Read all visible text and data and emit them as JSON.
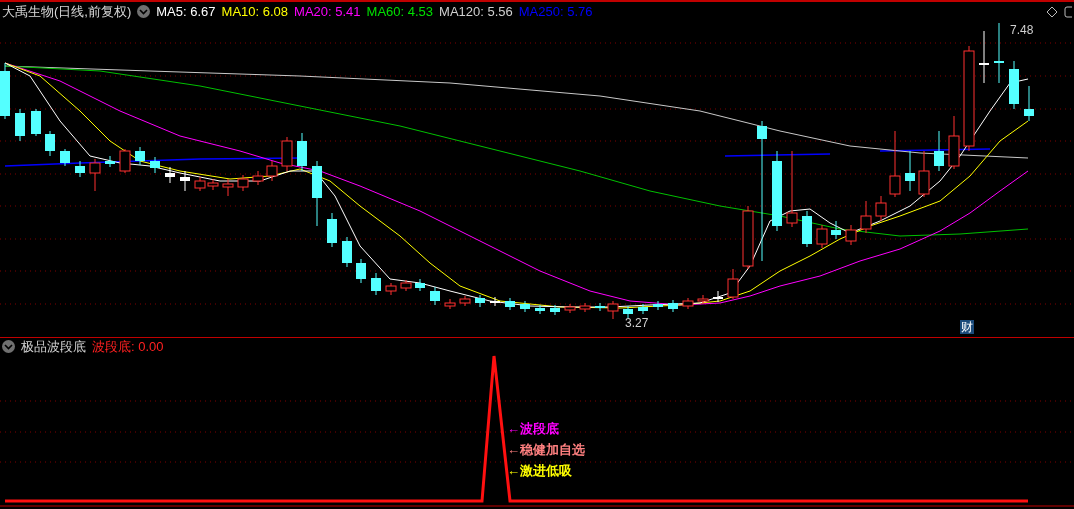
{
  "header": {
    "title": "大禹生物(日线,前复权)",
    "ma": [
      {
        "label": "MA5: 6.67",
        "color": "#ffffff"
      },
      {
        "label": "MA10: 6.08",
        "color": "#ffff00"
      },
      {
        "label": "MA20: 5.41",
        "color": "#ff00ff"
      },
      {
        "label": "MA60: 4.53",
        "color": "#00e000"
      },
      {
        "label": "MA120: 5.56",
        "color": "#d0d0d0"
      },
      {
        "label": "MA250: 5.76",
        "color": "#0000ff"
      }
    ]
  },
  "main_chart": {
    "high_label": "7.48",
    "low_label": "3.27",
    "badge": "财"
  },
  "indicator": {
    "title": "极品波段底",
    "reading": "波段底: 0.00",
    "annotations": [
      {
        "text": "←波段底",
        "color": "#ff00ff"
      },
      {
        "text": "←稳健加自选",
        "color": "#ff8080"
      },
      {
        "text": "←激进低吸",
        "color": "#ffff00"
      }
    ]
  }
}
